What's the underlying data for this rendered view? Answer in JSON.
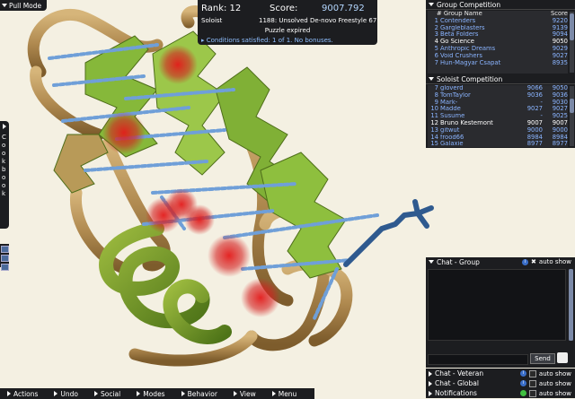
{
  "pull_mode": {
    "label": "Pull Mode"
  },
  "score_panel": {
    "rank_label": "Rank: 12",
    "score_label": "Score:",
    "score_value": "9007.792",
    "mode": "Soloist",
    "puzzle": "1188: Unsolved De-novo Freestyle 67",
    "status": "Puzzle expired",
    "conditions": "Conditions satisfied: 1 of 1. No bonuses."
  },
  "group_competition": {
    "title": "Group Competition",
    "headers": {
      "name": "# Group Name",
      "score": "Score"
    },
    "rows": [
      {
        "rank": "1",
        "name": "Contenders",
        "score": "9220"
      },
      {
        "rank": "2",
        "name": "Gargleblasters",
        "score": "9139"
      },
      {
        "rank": "3",
        "name": "Beta Folders",
        "score": "9094"
      },
      {
        "rank": "4",
        "name": "Go Science",
        "score": "9050",
        "highlight": true
      },
      {
        "rank": "5",
        "name": "Anthropic Dreams",
        "score": "9029"
      },
      {
        "rank": "6",
        "name": "Void Crushers",
        "score": "9027"
      },
      {
        "rank": "7",
        "name": "Hun-Magyar Csapat",
        "score": "8935"
      }
    ]
  },
  "soloist_competition": {
    "title": "Soloist Competition",
    "rows": [
      {
        "rank": "7",
        "name": "gloverd",
        "score": "9066",
        "score2": "9050"
      },
      {
        "rank": "8",
        "name": "TomTaylor",
        "score": "9036",
        "score2": "9036"
      },
      {
        "rank": "9",
        "name": "Mark-",
        "score": "-",
        "score2": "9030"
      },
      {
        "rank": "10",
        "name": "Madde",
        "score": "9027",
        "score2": "9027"
      },
      {
        "rank": "11",
        "name": "Susume",
        "score": "-",
        "score2": "9025"
      },
      {
        "rank": "12",
        "name": "Bruno Kestemont",
        "score": "9007",
        "score2": "9007",
        "highlight": true
      },
      {
        "rank": "13",
        "name": "gitwut",
        "score": "9000",
        "score2": "9000"
      },
      {
        "rank": "14",
        "name": "frood66",
        "score": "8984",
        "score2": "8984"
      },
      {
        "rank": "15",
        "name": "Galaxie",
        "score": "8977",
        "score2": "8977"
      }
    ]
  },
  "cookbook": {
    "label": "Cookbook"
  },
  "chat_group": {
    "title": "Chat - Group",
    "auto_show": "auto show",
    "send_label": "Send"
  },
  "chat_rows": [
    {
      "label": "Chat - Veteran",
      "auto_show": "auto show"
    },
    {
      "label": "Chat - Global",
      "auto_show": "auto show"
    },
    {
      "label": "Notifications",
      "auto_show": "auto show"
    }
  ],
  "bottom_menu": [
    "Actions",
    "Undo",
    "Social",
    "Modes",
    "Behavior",
    "View",
    "Menu"
  ],
  "colors": {
    "panel": "#1c1d20",
    "background": "#f4f0e2",
    "sheet_green": "#86b83a",
    "loop_tan": "#b08a50",
    "helix_green": "#6f9a2a",
    "clash_red": "#d42020",
    "hbond_blue": "#6f9fd8",
    "sidechain_blue": "#2f5a8f"
  }
}
